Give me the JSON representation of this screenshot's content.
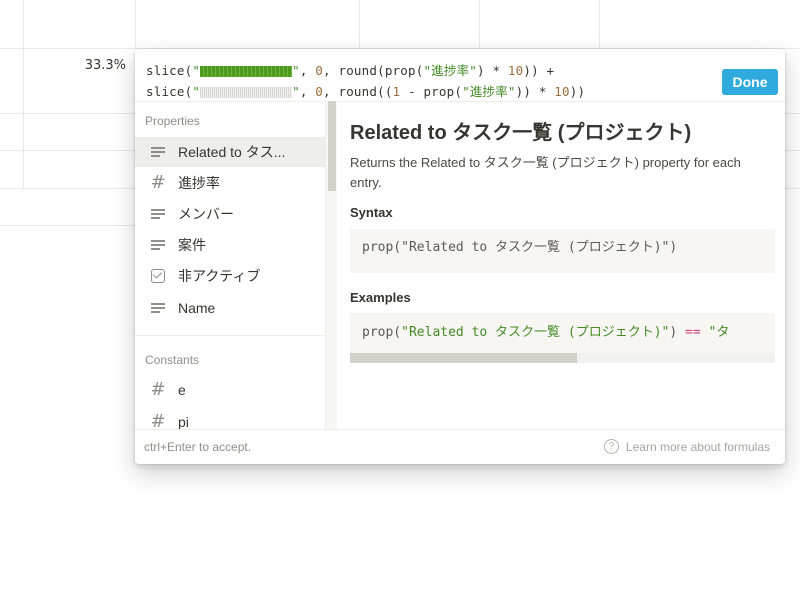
{
  "background_table": {
    "progress_cell": "33.3%"
  },
  "formula_editor": {
    "line1": {
      "fn_slice": "slice(",
      "q_open": "\"",
      "q_close": "\"",
      "comma_zero": ", ",
      "zero": "0",
      "after_zero": ", round(prop(",
      "prop_name": "\"進捗率\"",
      "mult": ") * ",
      "ten": "10",
      "end": ")) +"
    },
    "line2": {
      "fn_slice": "slice(",
      "q_open": "\"",
      "q_close": "\"",
      "comma_zero": ", ",
      "zero": "0",
      "after_zero": ", round((",
      "one": "1",
      "minus": " - prop(",
      "prop_name": "\"進捗率\"",
      "mult": ")) * ",
      "ten": "10",
      "end": "))"
    },
    "done_label": "Done"
  },
  "properties_section": {
    "title": "Properties",
    "items": [
      {
        "label": "Related to タス...",
        "icon": "text-icon"
      },
      {
        "label": "進捗率",
        "icon": "number-icon"
      },
      {
        "label": "メンバー",
        "icon": "text-icon"
      },
      {
        "label": "案件",
        "icon": "text-icon"
      },
      {
        "label": "非アクティブ",
        "icon": "checkbox-icon"
      },
      {
        "label": "Name",
        "icon": "text-icon"
      }
    ]
  },
  "constants_section": {
    "title": "Constants",
    "items": [
      {
        "label": "e",
        "icon": "number-icon"
      },
      {
        "label": "pi",
        "icon": "number-icon"
      }
    ]
  },
  "doc": {
    "title": "Related to タスク一覧 (プロジェクト)",
    "description": "Returns the Related to タスク一覧 (プロジェクト) property for each entry.",
    "syntax_heading": "Syntax",
    "syntax_code_fn": "prop(",
    "syntax_code_arg": "\"Related to タスク一覧 (プロジェクト)\"",
    "syntax_code_end": ")",
    "examples_heading": "Examples",
    "example_code_fn": "prop(",
    "example_code_arg": "\"Related to タスク一覧 (プロジェクト)\"",
    "example_code_mid": ") ",
    "example_code_op": "==",
    "example_code_tail": " \"タ"
  },
  "footer": {
    "hint": "ctrl+Enter to accept.",
    "learn_more": "Learn more about formulas"
  }
}
